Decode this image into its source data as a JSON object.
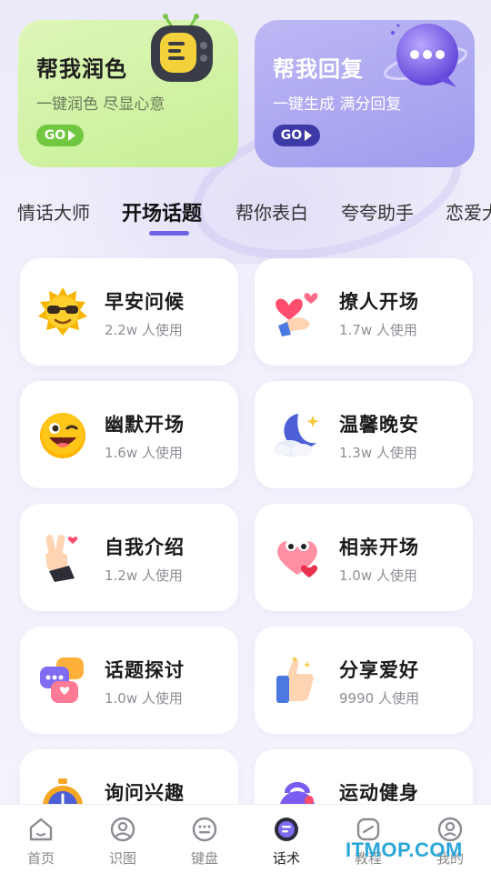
{
  "hero": {
    "left": {
      "title": "帮我润色",
      "subtitle": "一键润色 尽显心意",
      "go_label": "GO",
      "icon": "tv-icon",
      "color": "#c7ef96"
    },
    "right": {
      "title": "帮我回复",
      "subtitle": "一键生成 满分回复",
      "go_label": "GO",
      "icon": "chat-bubble-icon",
      "color": "#9f9bee"
    }
  },
  "tabs": [
    {
      "label": "情话大师",
      "active": false
    },
    {
      "label": "开场话题",
      "active": true
    },
    {
      "label": "帮你表白",
      "active": false
    },
    {
      "label": "夸夸助手",
      "active": false
    },
    {
      "label": "恋爱大",
      "active": false
    }
  ],
  "accent_color": "#6f63e5",
  "cards": [
    {
      "title": "早安问候",
      "usage": "2.2w 人使用",
      "icon": "sun-sunglasses-icon"
    },
    {
      "title": "撩人开场",
      "usage": "1.7w 人使用",
      "icon": "finger-heart-icon"
    },
    {
      "title": "幽默开场",
      "usage": "1.6w 人使用",
      "icon": "winking-face-icon"
    },
    {
      "title": "温馨晚安",
      "usage": "1.3w 人使用",
      "icon": "moon-cloud-icon"
    },
    {
      "title": "自我介绍",
      "usage": "1.2w 人使用",
      "icon": "peace-hand-icon"
    },
    {
      "title": "相亲开场",
      "usage": "1.0w 人使用",
      "icon": "heart-eyes-icon"
    },
    {
      "title": "话题探讨",
      "usage": "1.0w 人使用",
      "icon": "chat-bubbles-icon"
    },
    {
      "title": "分享爱好",
      "usage": "9990 人使用",
      "icon": "thumbs-up-icon"
    },
    {
      "title": "询问兴趣",
      "usage": "",
      "icon": "stopwatch-icon"
    },
    {
      "title": "运动健身",
      "usage": "",
      "icon": "kettlebell-icon"
    }
  ],
  "bottom_nav": [
    {
      "label": "首页",
      "icon": "home-icon",
      "active": false
    },
    {
      "label": "识图",
      "icon": "image-scan-icon",
      "active": false
    },
    {
      "label": "键盘",
      "icon": "keyboard-icon",
      "active": false
    },
    {
      "label": "话术",
      "icon": "chat-script-icon",
      "active": true
    },
    {
      "label": "教程",
      "icon": "tutorial-icon",
      "active": false
    },
    {
      "label": "我的",
      "icon": "profile-icon",
      "active": false
    }
  ],
  "watermark": "ITMOP.COM"
}
